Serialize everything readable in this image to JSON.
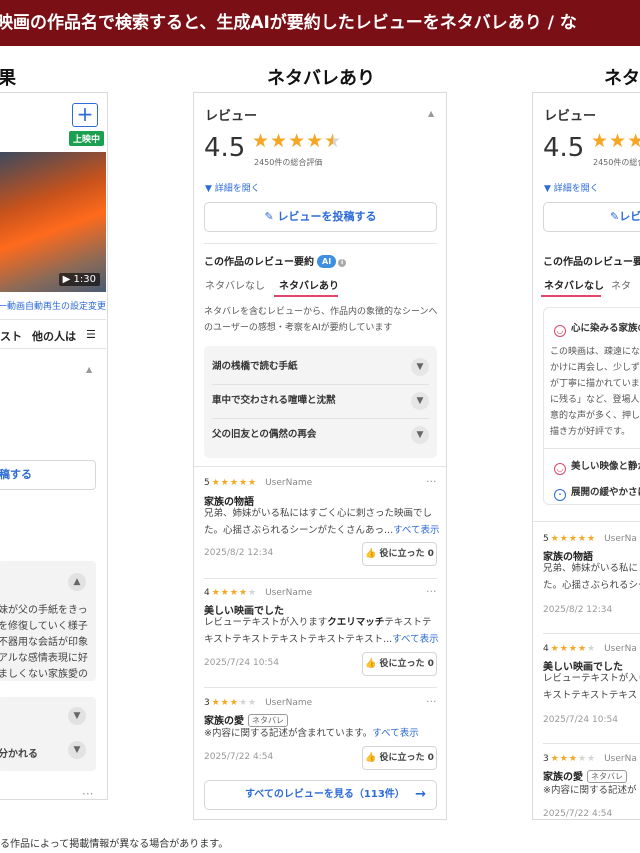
{
  "banner": "映画の作品名で検索すると、生成AIが要約したレビューをネタバレあり / な",
  "columns": {
    "left_title": "果",
    "center_title": "ネタバレあり",
    "right_title": "ネタ"
  },
  "left_panel": {
    "add_label": "+",
    "badge": "上映中",
    "video_duration": "▶ 1:30",
    "autoplay_link": "一動画自動再生の設定変更",
    "tab_a": "スト",
    "tab_b": "他の人は",
    "menu_icon": "☰",
    "post_label": "稿する",
    "text_lines": [
      "妹が父の手紙をきっ",
      "を修復していく様子",
      "不器用な会話が印象",
      "アルな感情表現に好",
      "ましくない家族愛の"
    ],
    "bottom_row": "分かれる",
    "dots": "···"
  },
  "review_panel": {
    "heading": "レビュー",
    "score": "4.5",
    "stars_filled": 4.5,
    "count_text": "2450件の総合評価",
    "detail_link": "▼ 詳細を開く",
    "post_button": "レビューを投稿する",
    "summary_title": "この作品のレビュー要約",
    "ai_badge": "AI",
    "tab_no_spoiler": "ネタバレなし",
    "tab_spoiler": "ネタバレあり",
    "description": "ネタバレを含むレビューから、作品内の象徴的なシーンへのユーザーの感想・考察をAIが要約しています",
    "accordion": [
      "湖の桟橋で読む手紙",
      "車中で交わされる喧嘩と沈黙",
      "父の旧友との偶然の再会"
    ],
    "reviews": [
      {
        "rating": "5",
        "stars": 5,
        "user": "UserName",
        "title": "家族の物語",
        "body": "兄弟、姉妹がいる私にはすごく心に刺さった映画でした。心揺さぶられるシーンがたくさんあっ...",
        "more": "すべて表示",
        "date": "2025/8/2 12:34",
        "helpful": "役に立った 0"
      },
      {
        "rating": "4",
        "stars": 4,
        "user": "UserName",
        "title": "美しい映画でした",
        "body_pre": "レビューテキストが入ります",
        "body_bold": "クエリマッチ",
        "body_post": "テキストテキストテキストテキストテキストテキスト...",
        "more": "すべて表示",
        "date": "2025/7/24 10:54",
        "helpful": "役に立った 0"
      },
      {
        "rating": "3",
        "stars": 3,
        "user": "UserName",
        "title": "家族の愛",
        "spoiler_tag": "ネタバレ",
        "body": "※内容に関する記述が含まれています。",
        "more": "すべて表示",
        "date": "2025/7/22 4:54",
        "helpful": "役に立った 0"
      }
    ],
    "all_reviews": "すべてのレビューを見る（113件）"
  },
  "right_panel": {
    "heading": "レビュー",
    "score": "4.5",
    "count_text": "2450件の総合",
    "detail_link": "▼ 詳細を開く",
    "post_button": "レビ",
    "summary_title": "この作品のレビュー要約",
    "tab_no_spoiler": "ネタバレなし",
    "tab_spoiler": "ネタ",
    "card_title": "心に染みる家族の",
    "card_lines": [
      "この映画は、疎遠にな",
      "かけに再会し、少しず",
      "が丁寧に描かれていま",
      "に残る」など、登場人",
      "意的な声が多く、押し",
      "描き方が好評です。"
    ],
    "line_beautiful": "美しい映像と静か",
    "line_development": "展開の緩やかさに",
    "reviews": [
      {
        "rating": "5",
        "stars": 5,
        "user": "UserNa",
        "title": "家族の物語",
        "lines": [
          "兄弟、姉妹がいる私に",
          "た。心揺さぶられるシー"
        ],
        "date": "2025/8/2 12:34"
      },
      {
        "rating": "4",
        "stars": 4,
        "user": "UserNa",
        "title": "美しい映画でした",
        "lines": [
          "レビューテキストが入り",
          "キストテキストテキスト"
        ],
        "date": "2025/7/24 10:54"
      },
      {
        "rating": "3",
        "stars": 3,
        "user": "UserNa",
        "title": "家族の愛",
        "spoiler_tag": "ネタバレ",
        "lines": [
          "※内容に関する記述が"
        ],
        "date": "2025/7/22 4:54"
      }
    ]
  },
  "footnote": "る作品によって掲載情報が異なる場合があります。",
  "colors": {
    "banner_bg": "#7a1016",
    "accent_blue": "#2d6bd6",
    "star": "#f5a623",
    "tab_underline": "#e0476a",
    "badge_green": "#1aa04f"
  }
}
